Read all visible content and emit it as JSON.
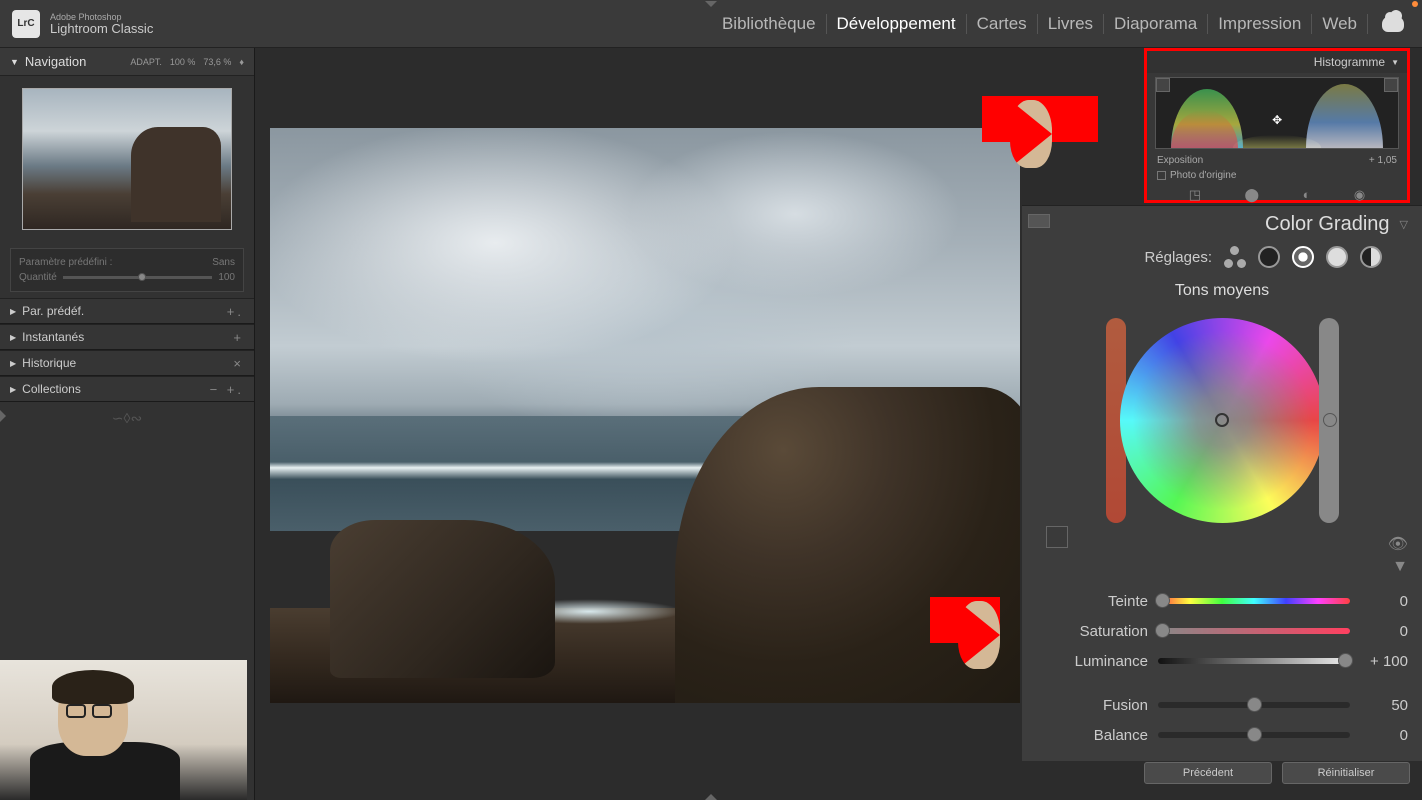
{
  "app": {
    "small": "Adobe Photoshop",
    "name": "Lightroom Classic",
    "logo": "LrC"
  },
  "modules": {
    "items": [
      "Bibliothèque",
      "Développement",
      "Cartes",
      "Livres",
      "Diaporama",
      "Impression",
      "Web"
    ],
    "active_index": 1
  },
  "nav": {
    "title": "Navigation",
    "mode": "ADAPT.",
    "zoom1": "100 %",
    "zoom2": "73,6 %"
  },
  "preset_box": {
    "label": "Paramètre prédéfini :",
    "value": "Sans",
    "qty_label": "Quantité",
    "qty_value": "100"
  },
  "left_sections": [
    {
      "label": "Par. prédéf.",
      "actions": "+."
    },
    {
      "label": "Instantanés",
      "actions": "+"
    },
    {
      "label": "Historique",
      "actions": "×"
    },
    {
      "label": "Collections",
      "actions": "− +."
    }
  ],
  "histogram": {
    "title": "Histogramme",
    "readout_label": "Exposition",
    "readout_value": "+ 1,05",
    "origin_label": "Photo d'origine"
  },
  "color_grading": {
    "title": "Color Grading",
    "modes_label": "Réglages:",
    "zone": "Tons moyens",
    "sliders": {
      "teinte": {
        "label": "Teinte",
        "value": "0",
        "pos": 0
      },
      "saturation": {
        "label": "Saturation",
        "value": "0",
        "pos": 0
      },
      "luminance": {
        "label": "Luminance",
        "value": "+ 100",
        "pos": 100
      },
      "fusion": {
        "label": "Fusion",
        "value": "50",
        "pos": 50
      },
      "balance": {
        "label": "Balance",
        "value": "0",
        "pos": 50
      }
    }
  },
  "buttons": {
    "prev": "Précédent",
    "reset": "Réinitialiser"
  }
}
